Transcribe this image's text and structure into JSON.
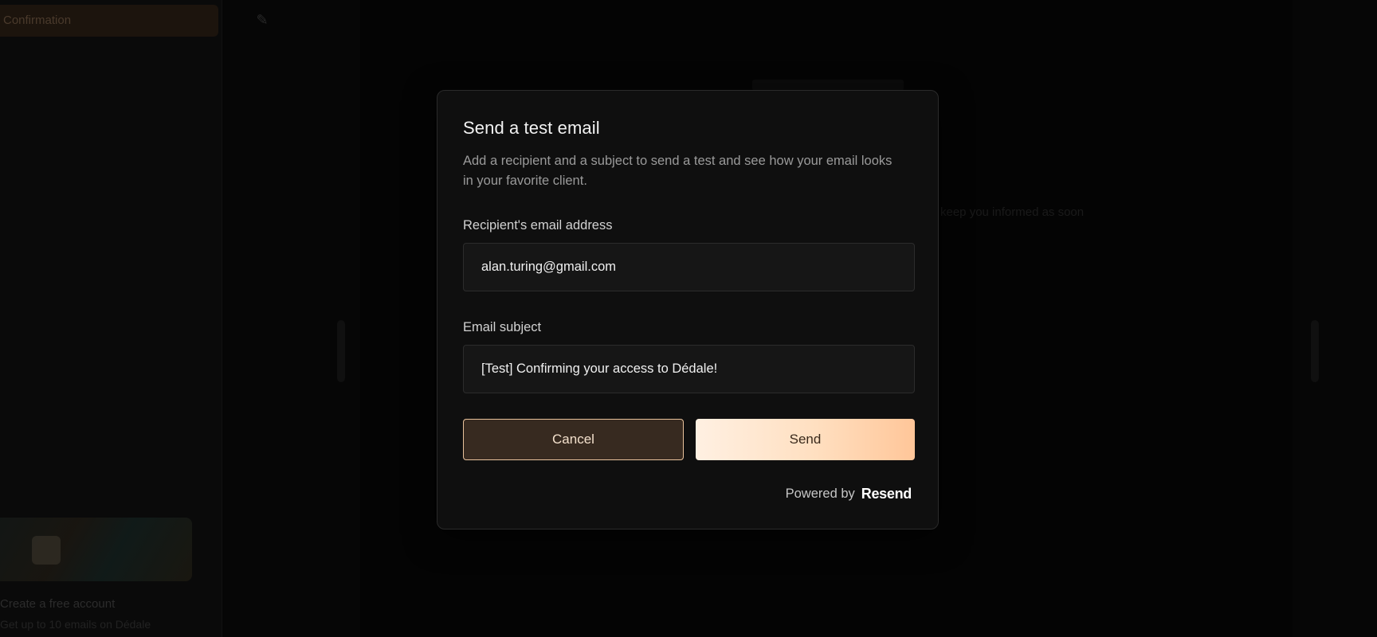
{
  "background": {
    "sidebar_active_item": "Confirmation",
    "sidebar_cta_title": "Create a free account",
    "sidebar_cta_subtitle": "Get up to 10 emails on Dédale",
    "canvas_text": "keep you informed as soon"
  },
  "modal": {
    "title": "Send a test email",
    "description": "Add a recipient and a subject to send a test and see how your email looks in your favorite client.",
    "recipient": {
      "label": "Recipient's email address",
      "value": "alan.turing@gmail.com"
    },
    "subject": {
      "label": "Email subject",
      "value": "[Test] Confirming your access to Dédale!"
    },
    "buttons": {
      "cancel": "Cancel",
      "send": "Send"
    },
    "footer": {
      "powered_by": "Powered by",
      "brand": "Resend"
    }
  },
  "colors": {
    "accent_border": "#e9c29c",
    "send_gradient_start": "#fff0e2",
    "send_gradient_end": "#ffc699",
    "modal_bg": "#0f0f0f"
  },
  "icons": {
    "top_tool": "pen-icon"
  }
}
